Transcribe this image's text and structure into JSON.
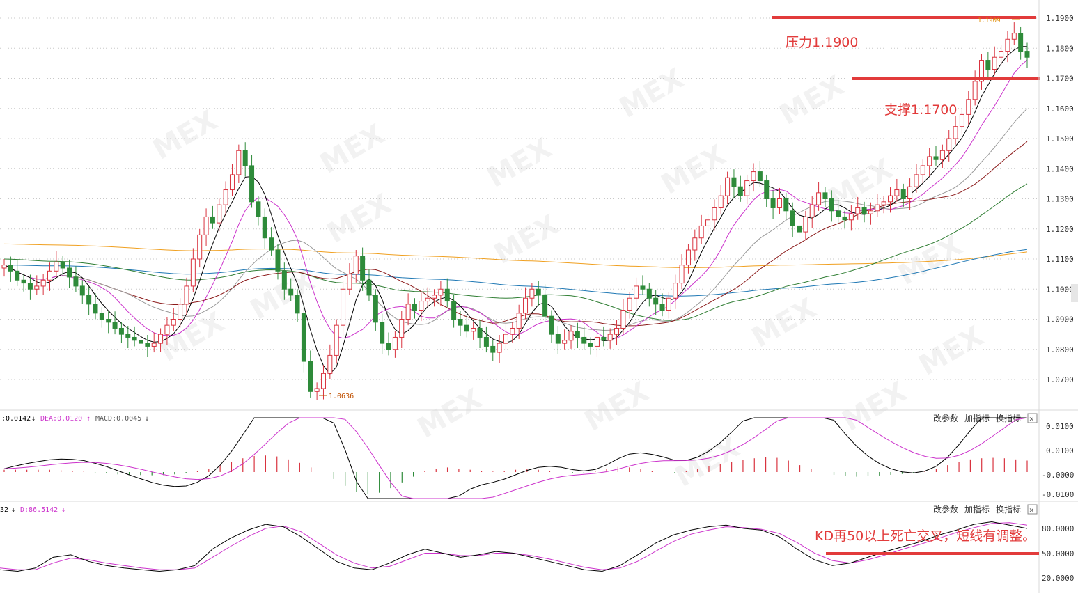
{
  "main_axis": {
    "ticks": [
      "1.1900",
      "1.1800",
      "1.1700",
      "1.1600",
      "1.1500",
      "1.1400",
      "1.1300",
      "1.1200",
      "1.1100",
      "1.1000",
      "1.0900",
      "1.0800",
      "1.0700"
    ],
    "tick_values": [
      1.19,
      1.18,
      1.17,
      1.16,
      1.15,
      1.14,
      1.13,
      1.12,
      1.11,
      1.1,
      1.09,
      1.08,
      1.07
    ]
  },
  "annotations": {
    "resistance": "压力1.1900",
    "support": "支撑1.1700",
    "kd_note": "KD再50以上死亡交叉，短线有调整。",
    "high_label": "1.1909",
    "low_label": "1.0636"
  },
  "macd_panel": {
    "dif_label": ":0.0142",
    "dea_label": "DEA:0.0120",
    "macd_label": "MACD:0.0045",
    "ticks": [
      "0.0100",
      "0.0100",
      "-0.0000",
      "-0.0100"
    ]
  },
  "kd_panel": {
    "k_label": "32",
    "d_label": "D:86.5142",
    "ticks": [
      "80.0000",
      "50.0000",
      "20.0000"
    ]
  },
  "buttons": {
    "params": "改参数",
    "add_indicator": "加指标",
    "switch_indicator": "换指标",
    "close": "✕"
  },
  "watermark": "MEX",
  "colors": {
    "up": "#d9333f",
    "down": "#2e8b3a",
    "ma5": "#000000",
    "ma10": "#cc33cc",
    "ma20": "#999999",
    "ma30": "#8b1a1a",
    "ma60": "#2e7d32",
    "ma120": "#1f78b4",
    "ma250": "#f0a020",
    "annotation": "#e23b3b"
  },
  "chart_data": {
    "type": "candlestick",
    "instrument_hint": "",
    "levels": {
      "resistance": 1.19,
      "support": 1.17,
      "kd_threshold": 50
    },
    "extremes": {
      "high": 1.1909,
      "low": 1.0636
    },
    "closes": [
      1.108,
      1.106,
      1.103,
      1.102,
      1.1,
      1.101,
      1.103,
      1.106,
      1.109,
      1.107,
      1.104,
      1.101,
      1.098,
      1.095,
      1.092,
      1.09,
      1.089,
      1.087,
      1.085,
      1.084,
      1.083,
      1.082,
      1.081,
      1.082,
      1.085,
      1.088,
      1.09,
      1.095,
      1.101,
      1.11,
      1.118,
      1.124,
      1.122,
      1.128,
      1.133,
      1.138,
      1.146,
      1.141,
      1.129,
      1.124,
      1.117,
      1.113,
      1.106,
      1.1,
      1.098,
      1.092,
      1.076,
      1.066,
      1.067,
      1.072,
      1.078,
      1.088,
      1.1,
      1.105,
      1.111,
      1.103,
      1.098,
      1.089,
      1.082,
      1.08,
      1.084,
      1.09,
      1.095,
      1.093,
      1.096,
      1.097,
      1.098,
      1.1,
      1.096,
      1.09,
      1.088,
      1.086,
      1.087,
      1.084,
      1.081,
      1.079,
      1.082,
      1.085,
      1.087,
      1.092,
      1.097,
      1.1,
      1.098,
      1.091,
      1.085,
      1.082,
      1.083,
      1.086,
      1.084,
      1.082,
      1.081,
      1.084,
      1.083,
      1.085,
      1.087,
      1.093,
      1.097,
      1.101,
      1.1,
      1.097,
      1.095,
      1.093,
      1.097,
      1.102,
      1.108,
      1.113,
      1.117,
      1.121,
      1.123,
      1.127,
      1.131,
      1.137,
      1.134,
      1.131,
      1.136,
      1.139,
      1.136,
      1.13,
      1.127,
      1.13,
      1.126,
      1.121,
      1.119,
      1.124,
      1.128,
      1.132,
      1.13,
      1.126,
      1.124,
      1.123,
      1.125,
      1.127,
      1.125,
      1.126,
      1.128,
      1.129,
      1.131,
      1.133,
      1.13,
      1.134,
      1.138,
      1.141,
      1.144,
      1.143,
      1.146,
      1.15,
      1.154,
      1.158,
      1.163,
      1.169,
      1.176,
      1.173,
      1.177,
      1.179,
      1.183,
      1.185,
      1.179,
      1.177
    ],
    "macd": {
      "dif_last": 0.0142,
      "dea_last": 0.012,
      "macd_last": 0.0045,
      "histogram": [
        0.001,
        0.001,
        0.001,
        0.001,
        0.001,
        0.0008,
        0.0005,
        0.0002,
        -0.0003,
        -0.0006,
        -0.001,
        -0.0012,
        -0.0013,
        -0.0014,
        -0.0013,
        -0.001,
        -0.0005,
        0.0005,
        0.0015,
        0.003,
        0.0045,
        0.006,
        0.007,
        0.0072,
        0.0068,
        0.0055,
        0.004,
        0.002,
        0.0,
        -0.003,
        -0.006,
        -0.0085,
        -0.0095,
        -0.009,
        -0.007,
        -0.0045,
        -0.002,
        0.0005,
        0.0015,
        0.002,
        0.0015,
        0.001,
        0.0005,
        0.0002,
        0.0005,
        0.001,
        0.0012,
        0.001,
        0.0005,
        0.0,
        -0.0005,
        -0.0003,
        0.0005,
        0.0015,
        0.0022,
        0.002,
        0.0012,
        0.0004,
        0.0,
        -0.0003,
        0.0005,
        0.0015,
        0.0025,
        0.0035,
        0.0045,
        0.0052,
        0.006,
        0.0065,
        0.0062,
        0.005,
        0.003,
        0.0015,
        0.0,
        -0.0012,
        -0.0018,
        -0.002,
        -0.0018,
        -0.0015,
        -0.0012,
        -0.0008,
        -0.0003,
        0.0005,
        0.0015,
        0.003,
        0.0045,
        0.0055,
        0.006,
        0.0062,
        0.006,
        0.0055,
        0.005
      ]
    },
    "kd": {
      "d_last": 86.5142,
      "k": [
        30,
        28,
        32,
        45,
        48,
        40,
        35,
        32,
        30,
        28,
        30,
        35,
        55,
        68,
        78,
        85,
        82,
        70,
        55,
        40,
        32,
        30,
        38,
        48,
        55,
        50,
        45,
        48,
        52,
        50,
        45,
        40,
        35,
        30,
        28,
        35,
        48,
        62,
        72,
        78,
        82,
        84,
        80,
        78,
        70,
        55,
        42,
        35,
        38,
        45,
        52,
        58,
        64,
        72,
        78,
        85,
        88,
        84,
        80
      ],
      "d": [
        32,
        30,
        30,
        38,
        44,
        42,
        38,
        35,
        32,
        30,
        30,
        32,
        45,
        58,
        70,
        80,
        83,
        76,
        62,
        48,
        38,
        32,
        34,
        42,
        50,
        50,
        47,
        47,
        50,
        50,
        47,
        43,
        38,
        33,
        30,
        32,
        40,
        52,
        64,
        73,
        78,
        82,
        81,
        79,
        74,
        63,
        50,
        41,
        38,
        42,
        48,
        55,
        61,
        68,
        75,
        81,
        86,
        87,
        84
      ]
    }
  }
}
